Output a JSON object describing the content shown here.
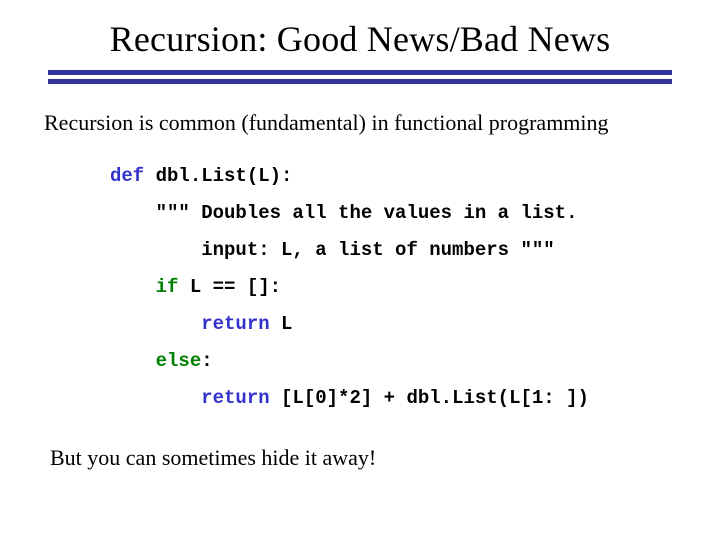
{
  "title": "Recursion: Good News/Bad News",
  "intro": "Recursion is common (fundamental) in functional programming",
  "code": {
    "kw_def": "def",
    "line1_rest": " dbl.List(L):",
    "line2": "    \"\"\" Doubles all the values in a list.",
    "line3": "        input: L, a list of numbers \"\"\"",
    "kw_if": "if",
    "line4_rest": " L == []:",
    "kw_return1": "return",
    "line5_rest": " L",
    "kw_else": "else",
    "line6_rest": ":",
    "kw_return2": "return",
    "line7_rest": " [L[0]*2] + dbl.List(L[1: ])"
  },
  "outro": "But you can sometimes hide it away!"
}
